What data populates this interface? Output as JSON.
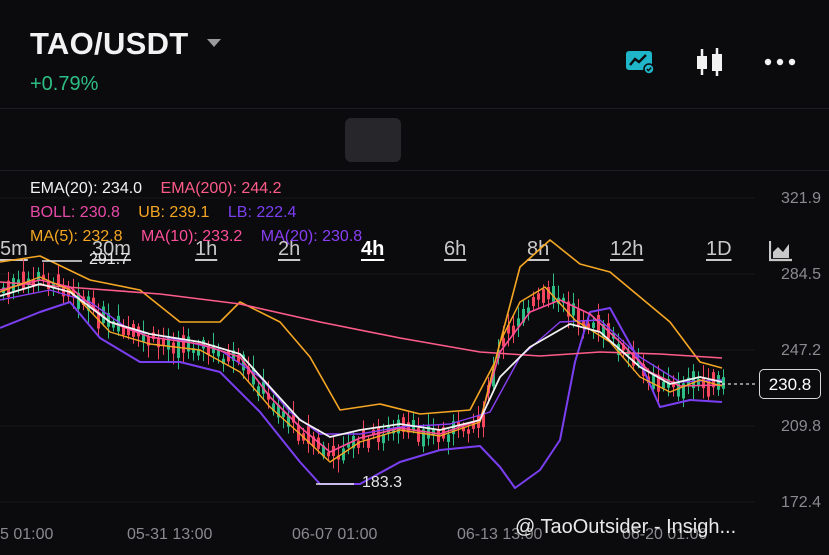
{
  "header": {
    "pair": "TAO/USDT",
    "change": "+0.79%",
    "icons": [
      "chart-settings-icon",
      "candlestick-icon",
      "more-icon"
    ]
  },
  "tabs": [
    {
      "label": "5m",
      "active": false
    },
    {
      "label": "30m",
      "active": false
    },
    {
      "label": "1h",
      "active": false
    },
    {
      "label": "2h",
      "active": false
    },
    {
      "label": "4h",
      "active": true
    },
    {
      "label": "6h",
      "active": false
    },
    {
      "label": "8h",
      "active": false
    },
    {
      "label": "12h",
      "active": false
    },
    {
      "label": "1D",
      "active": false
    }
  ],
  "indicators": {
    "ema20": "EMA(20): 234.0",
    "ema200": "EMA(200): 244.2",
    "boll": "BOLL: 230.8",
    "ub": "UB: 239.1",
    "lb": "LB: 222.4",
    "ma5": "MA(5): 232.8",
    "ma10": "MA(10): 233.2",
    "ma20": "MA(20): 230.8"
  },
  "colors": {
    "ema20": "#f2f2f2",
    "ema200": "#ff5c8a",
    "boll": "#e84aa7",
    "ub": "#f5a623",
    "lb": "#7b3ff2",
    "ma5": "#f5a623",
    "ma10": "#ff4f9a",
    "ma20": "#8a3ff5",
    "up": "#2ebd85",
    "down": "#f6465d",
    "accent": "#1fb6c9"
  },
  "y_axis": [
    "321.9",
    "284.5",
    "247.2",
    "209.8",
    "172.4"
  ],
  "x_axis": [
    "5 01:00",
    "05-31 13:00",
    "06-07 01:00",
    "06-13 13:00",
    "06-20 01:00"
  ],
  "price_tag": "230.8",
  "high_label": "291.7",
  "low_label": "183.3",
  "watermark": "@ TaoOutsider - Insigh..."
}
